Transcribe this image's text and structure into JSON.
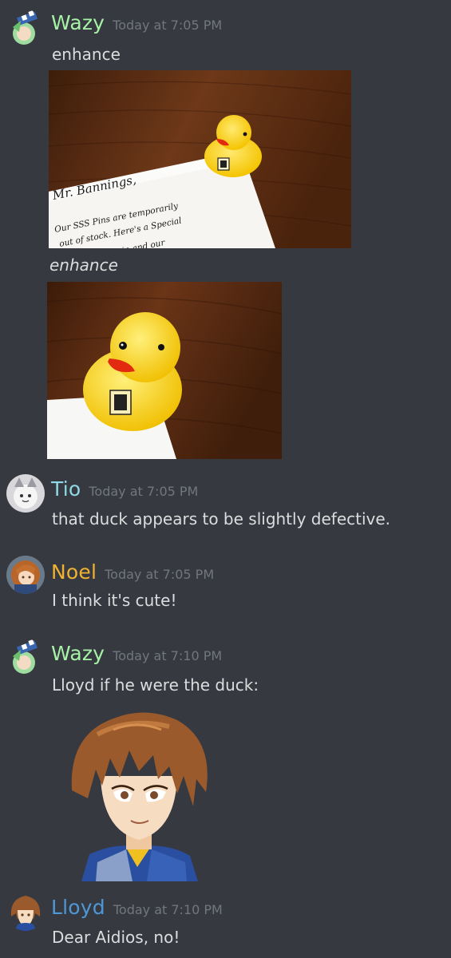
{
  "colors": {
    "background": "#36393f",
    "wazy": "#a6f2a6",
    "tio": "#8fd9e6",
    "noel": "#f0b232",
    "lloyd": "#4f98d8",
    "timestamp": "#72767d",
    "text": "#dcddde"
  },
  "messages": [
    {
      "author": "Wazy",
      "timestamp": "Today at 7:05 PM",
      "text": "enhance",
      "attachment1": {
        "heading": "Mr. Bannings,",
        "line1": "Our SSS Pins are temporarily",
        "line2": "out of stock. Here's a Special",
        "line3": "Boss pin and our"
      },
      "caption": "enhance"
    },
    {
      "author": "Tio",
      "timestamp": "Today at 7:05 PM",
      "text": "that duck appears to be slightly defective."
    },
    {
      "author": "Noel",
      "timestamp": "Today at 7:05 PM",
      "text": "I think it's cute!"
    },
    {
      "author": "Wazy",
      "timestamp": "Today at 7:10 PM",
      "text": "Lloyd if he were the duck:"
    },
    {
      "author": "Lloyd",
      "timestamp": "Today at 7:10 PM",
      "text": "Dear Aidios, no!"
    }
  ]
}
